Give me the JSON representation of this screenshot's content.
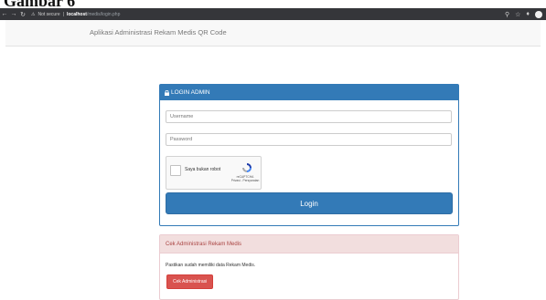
{
  "caption": "Gambar 6",
  "browser": {
    "back_icon": "arrow-left-icon",
    "forward_icon": "arrow-right-icon",
    "reload_icon": "reload-icon",
    "not_secure": "Not secure",
    "host": "localhost",
    "path": "/medis/login.php",
    "zoom_icon": "zoom-icon",
    "star_icon": "star-icon",
    "extension_icon": "puzzle-icon"
  },
  "app": {
    "brand": "Aplikasi Administrasi Rekam Medis QR Code"
  },
  "login": {
    "title": "LOGIN ADMIN",
    "username_placeholder": "Username",
    "password_placeholder": "Password",
    "captcha_label": "Saya bukan robot",
    "captcha_brand": "reCAPTCHA",
    "captcha_links": "Privasi - Persyaratan",
    "submit_label": "Login",
    "accent": "#337ab7"
  },
  "check": {
    "title": "Cek Administrasi Rekam Medis",
    "description": "Pastikan sudah memiliki data Rekam Medis.",
    "button_label": "Cek Administrasi",
    "accent": "#d9534f"
  }
}
